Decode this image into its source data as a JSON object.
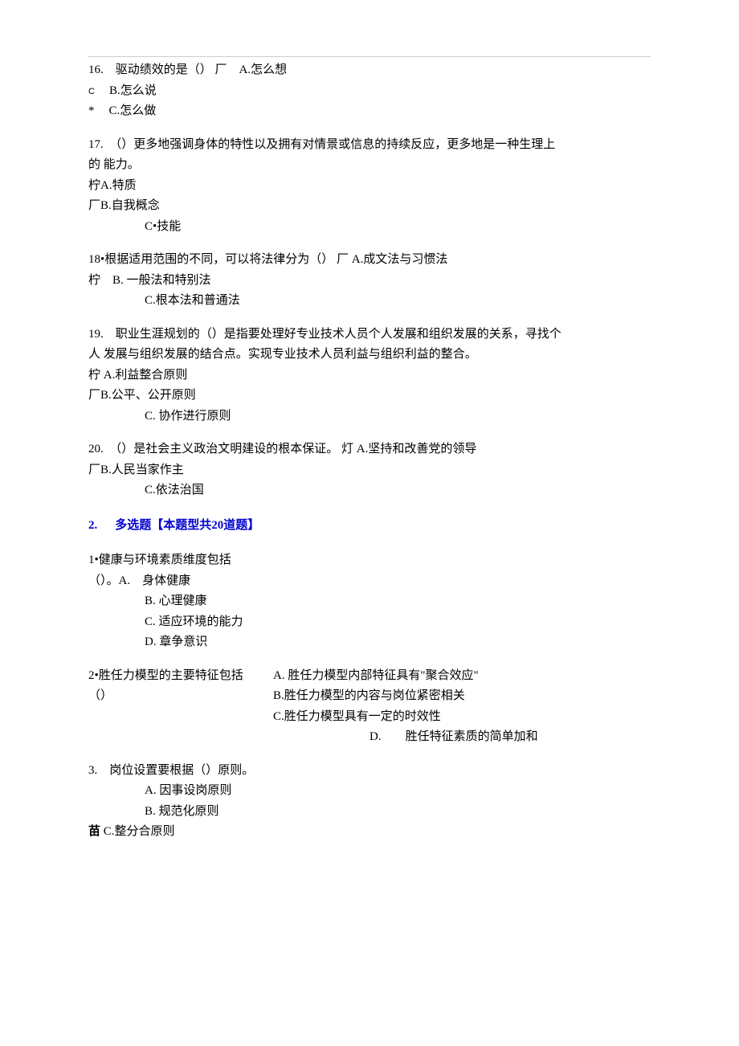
{
  "hr": "",
  "q16": {
    "stem": "16.　驱动绩效的是（） 厂　A.怎么想",
    "bmark": "C",
    "b": "B.怎么说",
    "cmark": "*",
    "c": "C.怎么做"
  },
  "q17": {
    "stem1": "17.　（）更多地强调身体的特性以及拥有对情景或信息的持续反应，更多地是一种生理上",
    "stem2": "的 能力。",
    "a": "柠A.特质",
    "b": "厂B.自我概念",
    "c": "C•技能"
  },
  "q18": {
    "stem": "18•根据适用范围的不同，可以将法律分为（） 厂 A.成文法与习惯法",
    "b": "柠　B. 一般法和特别法",
    "c": "C.根本法和普通法"
  },
  "q19": {
    "stem1": "19.　职业生涯规划的（）是指要处理好专业技术人员个人发展和组织发展的关系，寻找个",
    "stem2": "人 发展与组织发展的结合点。实现专业技术人员利益与组织利益的整合。",
    "a": "柠 A.利益整合原则",
    "b": "厂B.公平、公开原则",
    "c": "C. 协作进行原则"
  },
  "q20": {
    "stem": "20.　（）是社会主义政治文明建设的根本保证。 灯 A.坚持和改善党的领导",
    "b": " 厂B.人民当家作主",
    "c": "C.依法治国"
  },
  "section2": {
    "num": "2.",
    "title": "多选题【本题型共20道题】"
  },
  "mq1": {
    "stem1": "1•健康与环境素质维度包括",
    "stem2": "（）。A.　身体健康",
    "b": "B. 心理健康",
    "c": "C. 适应环境的能力",
    "d": "D. 章争意识"
  },
  "mq2": {
    "stemL1": "2•胜任力模型的主要特征包括",
    "stemL2": "（）",
    "a": "A. 胜任力模型内部特征具有\"聚合效应\"",
    "b": "B.胜任力模型的内容与岗位紧密相关",
    "c": "C.胜任力模型具有一定的时效性",
    "dLabel": "D.",
    "dText": "胜任特征素质的简单加和"
  },
  "mq3": {
    "stem": "3.　岗位设置要根据（）原则。",
    "a": "A. 因事设岗原则",
    "b": "B. 规范化原则",
    "cmark": "苗 ",
    "c": "C.整分合原则"
  }
}
